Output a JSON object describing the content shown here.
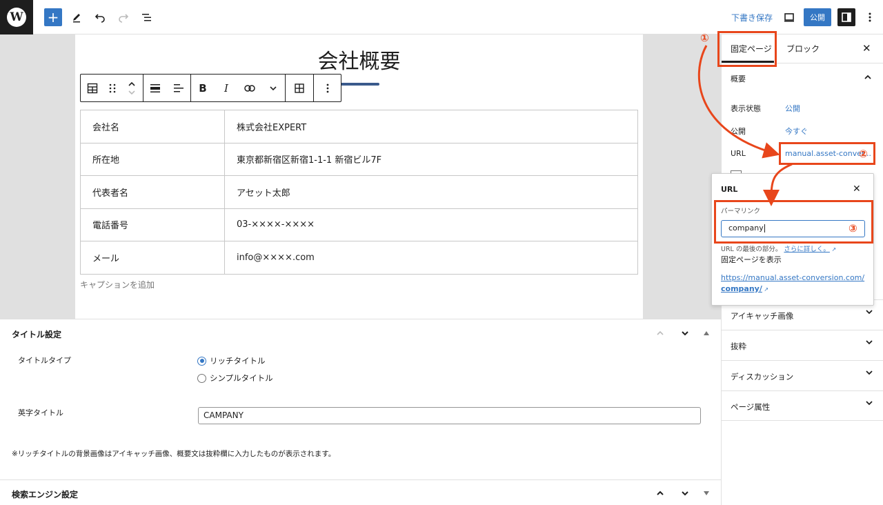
{
  "topbar": {
    "logo": "W",
    "save_draft": "下書き保存",
    "publish": "公開"
  },
  "editor": {
    "page_title": "会社概要",
    "table_rows": [
      {
        "label": "会社名",
        "value": "株式会社EXPERT"
      },
      {
        "label": "所在地",
        "value": "東京都新宿区新宿1-1-1 新宿ビル7F"
      },
      {
        "label": "代表者名",
        "value": "アセット太郎"
      },
      {
        "label": "電話番号",
        "value": "03-××××-××××"
      },
      {
        "label": "メール",
        "value": "info@××××.com"
      }
    ],
    "caption_placeholder": "キャプションを追加",
    "toolbar": {
      "bold": "B",
      "italic": "I"
    }
  },
  "meta": {
    "title_settings": "タイトル設定",
    "title_type_label": "タイトルタイプ",
    "option_rich": "リッチタイトル",
    "option_simple": "シンプルタイトル",
    "english_title_label": "英字タイトル",
    "english_title_value": "CAMPANY",
    "note": "※リッチタイトルの背景画像はアイキャッチ画像、概要文は抜粋欄に入力したものが表示されます。",
    "seo_settings": "検索エンジン設定"
  },
  "sidebar": {
    "tab_page": "固定ページ",
    "tab_block": "ブロック",
    "summary": "概要",
    "visibility_label": "表示状態",
    "visibility_value": "公開",
    "publish_label": "公開",
    "publish_value": "今すぐ",
    "url_label": "URL",
    "url_value": "manual.asset-conver...",
    "sections": [
      "アイキャッチ画像",
      "抜粋",
      "ディスカッション",
      "ページ属性"
    ]
  },
  "popover": {
    "title": "URL",
    "permalink_label": "パーマリンク",
    "slug": "company",
    "help": "URL の最後の部分。",
    "help_link": "さらに詳しく。",
    "view_label": "固定ページを表示",
    "link_line1": "https://manual.asset-conversion.com/",
    "link_line2": "company/"
  },
  "annotations": [
    "①",
    "②",
    "③"
  ],
  "colors": {
    "accent": "#3477c4",
    "annotation": "#e8461b",
    "dark": "#1e1e1e"
  }
}
